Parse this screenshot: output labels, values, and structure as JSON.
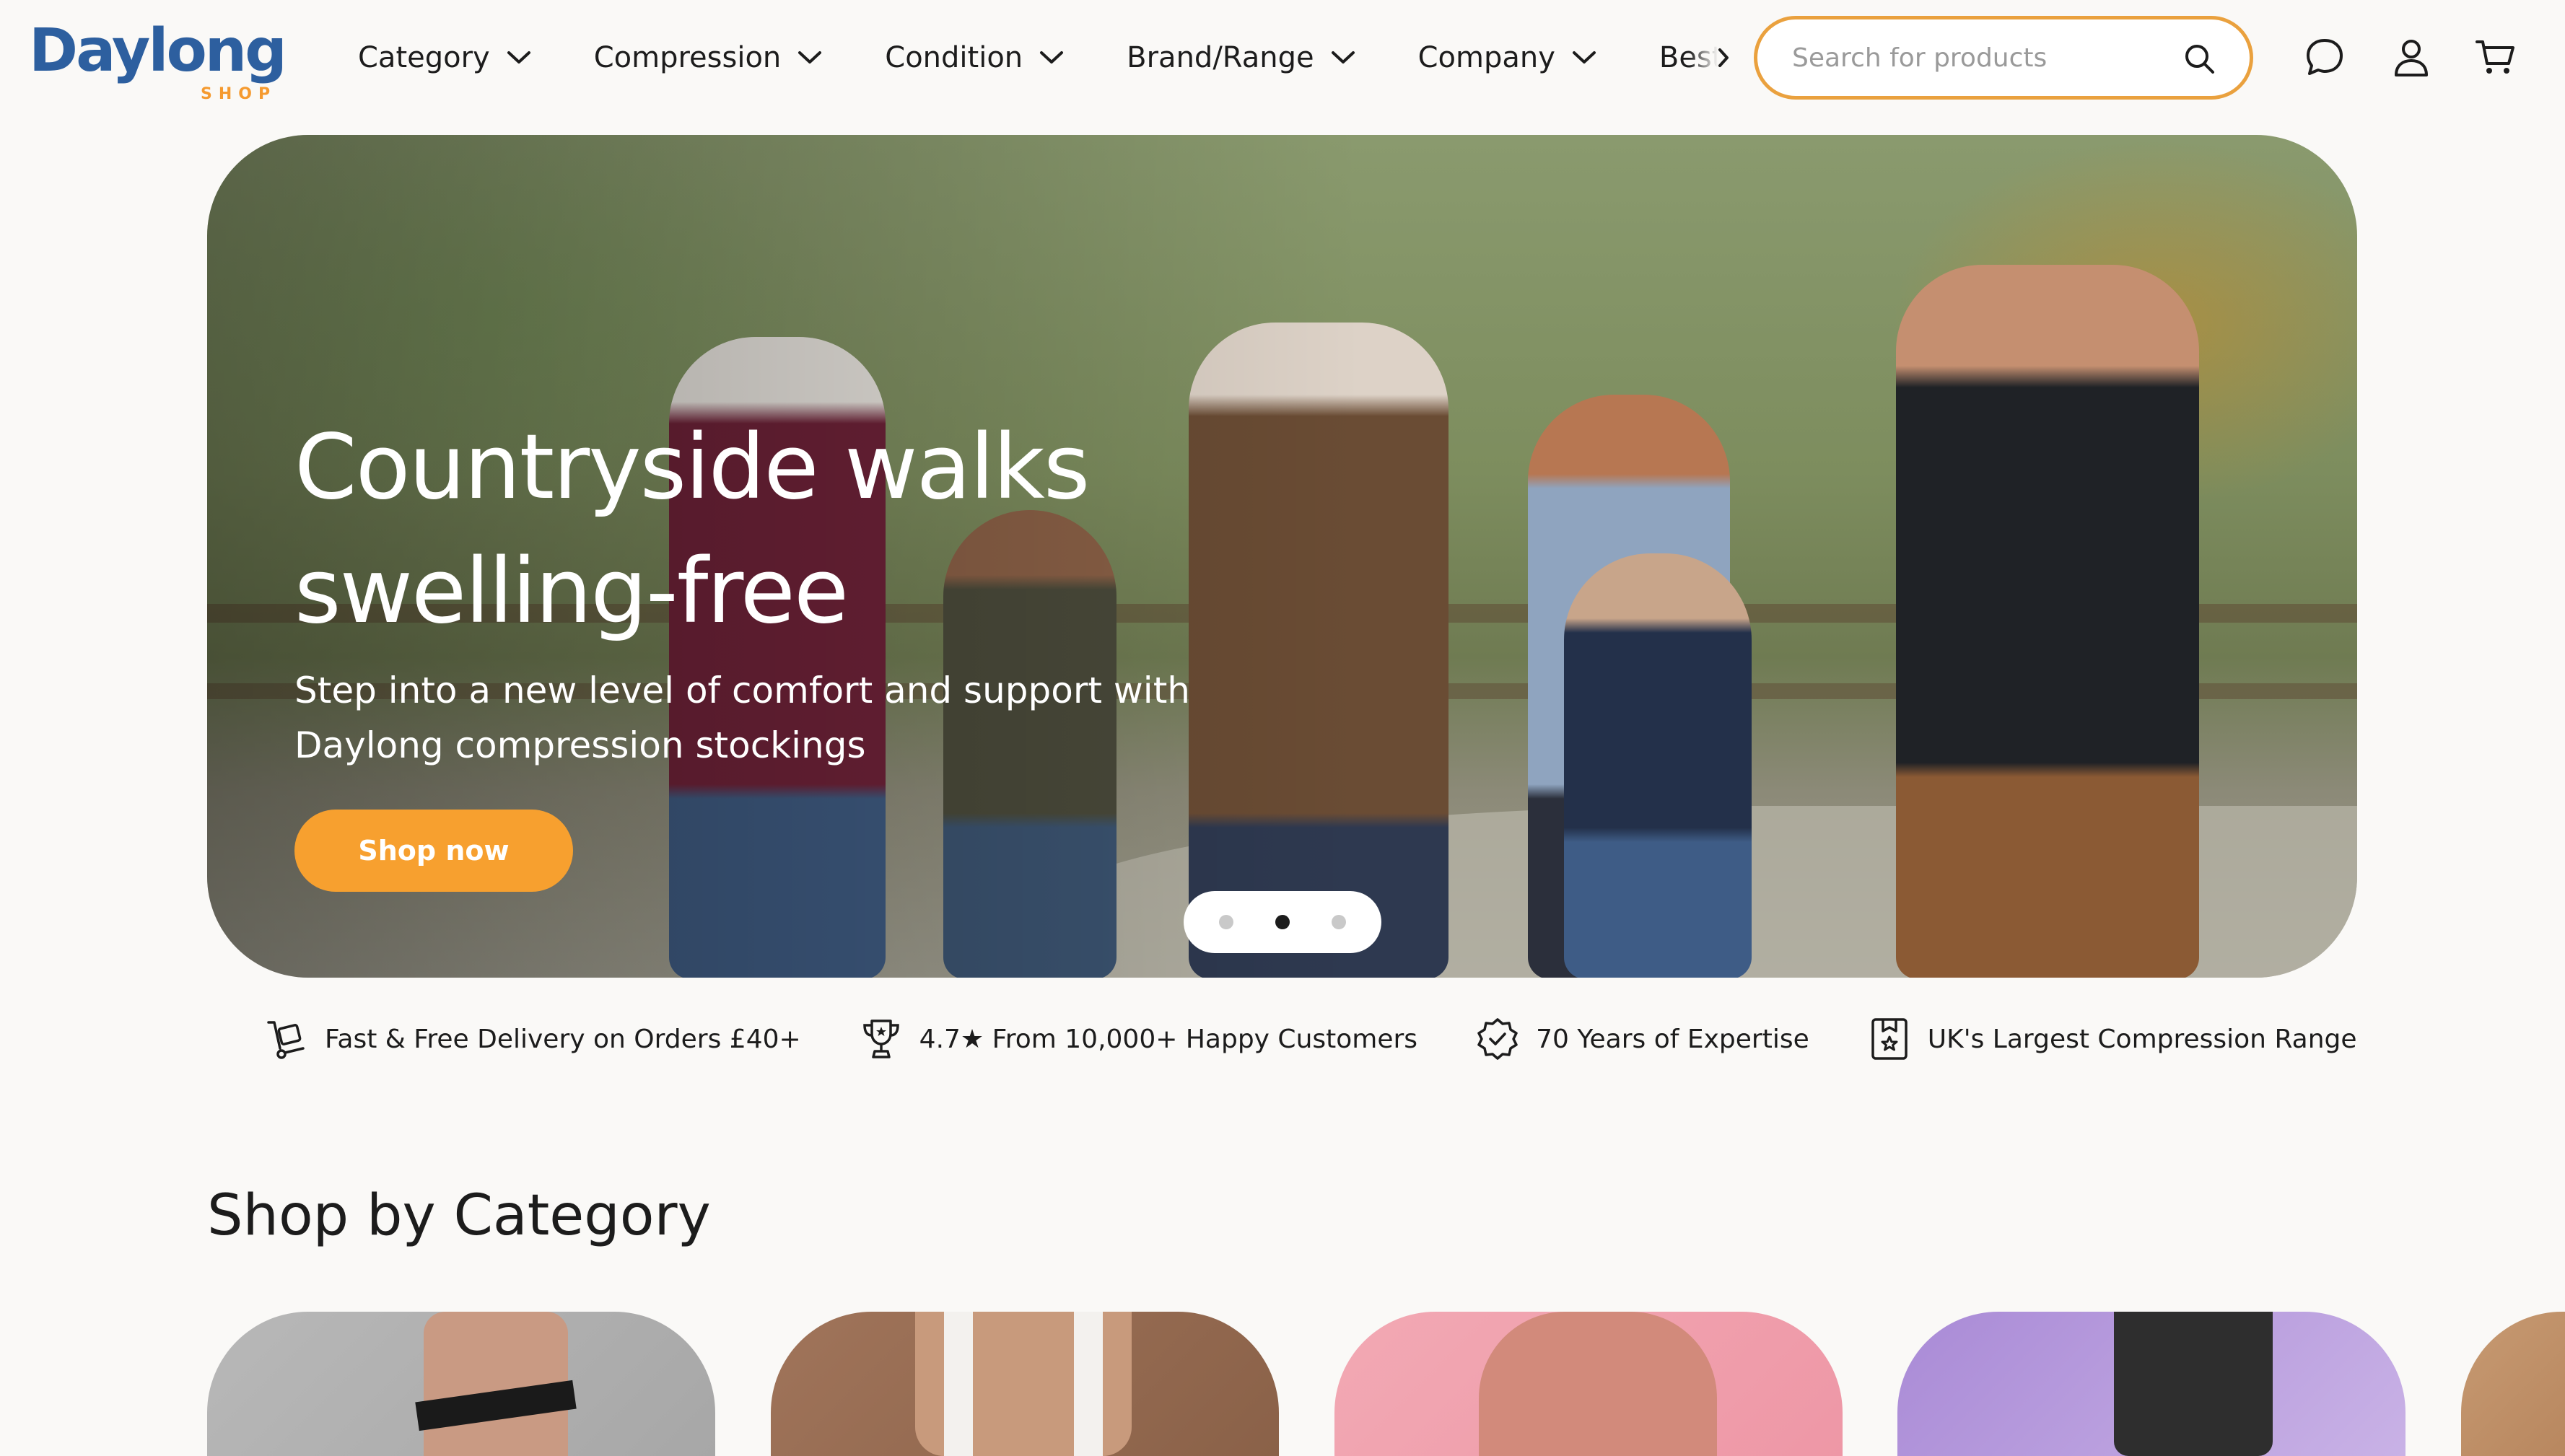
{
  "header": {
    "logo_word": "Daylong",
    "logo_sub": "SHOP",
    "nav": [
      {
        "label": "Category"
      },
      {
        "label": "Compression"
      },
      {
        "label": "Condition"
      },
      {
        "label": "Brand/Range"
      },
      {
        "label": "Company"
      },
      {
        "label": "Bestsellers"
      }
    ],
    "search_placeholder": "Search for products",
    "icons": [
      "chat-icon",
      "account-icon",
      "cart-icon"
    ]
  },
  "hero": {
    "title_line1": "Countryside walks",
    "title_line2": "swelling-free",
    "subtitle": "Step into a new level of comfort and support with Daylong compression stockings",
    "cta": "Shop now",
    "slides": 3,
    "active_slide": 2
  },
  "features": [
    {
      "icon": "delivery-icon",
      "text": "Fast & Free Delivery on Orders £40+"
    },
    {
      "icon": "trophy-icon",
      "text": "4.7★ From 10,000+ Happy Customers"
    },
    {
      "icon": "badge-check-icon",
      "text": "70 Years of Expertise"
    },
    {
      "icon": "star-bookmark-icon",
      "text": "UK's Largest Compression Range"
    }
  ],
  "categories_title": "Shop by Category",
  "colors": {
    "brand_blue": "#2d5f9f",
    "accent_orange": "#f7a02f",
    "search_border": "#eaa13e",
    "background": "#faf9f7"
  }
}
